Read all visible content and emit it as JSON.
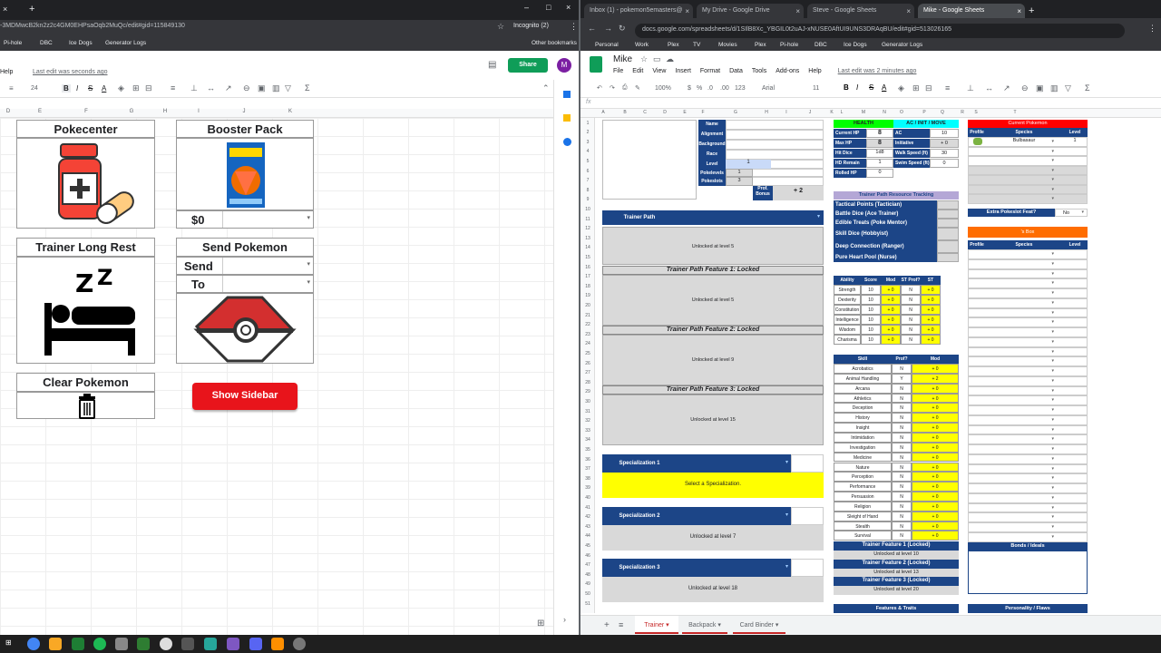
{
  "left": {
    "url": "-3MDMwcB2kn2z2c4GM0EHPsaOqb2MuQc/edit#gid=115849130",
    "incognito": "Incognito (2)",
    "bookmarks": [
      "Pi-hole",
      "DBC",
      "Ice Dogs",
      "Generator Logs"
    ],
    "other_bookmarks": "Other bookmarks",
    "menu_help": "Help",
    "last_edit": "Last edit was seconds ago",
    "share": "Share",
    "avatar": "M",
    "font_size": "24",
    "columns": [
      "D",
      "E",
      "F",
      "G",
      "H",
      "I",
      "J",
      "K"
    ],
    "cards": {
      "pokecenter": "Pokecenter",
      "booster": "Booster Pack",
      "money": "$0",
      "long_rest": "Trainer Long Rest",
      "send_pokemon": "Send Pokemon",
      "send": "Send",
      "to": "To",
      "clear_pokemon": "Clear Pokemon",
      "show_sidebar": "Show Sidebar"
    }
  },
  "right": {
    "tabs": [
      "Inbox (1) - pokemon5emasters@",
      "My Drive - Google Drive",
      "Steve - Google Sheets",
      "Mike - Google Sheets"
    ],
    "url": "docs.google.com/spreadsheets/d/1SIlB8Xc_YBGIL0t2uAJ-xNUSE0AftUI9UNS3DRAqBU/edit#gid=513026165",
    "bookmarks": [
      "Personal",
      "Work",
      "Plex",
      "TV",
      "Movies",
      "Plex",
      "Pi-hole",
      "DBC",
      "Ice Dogs",
      "Generator Logs"
    ],
    "title": "Mike",
    "menu": [
      "File",
      "Edit",
      "View",
      "Insert",
      "Format",
      "Data",
      "Tools",
      "Add-ons",
      "Help"
    ],
    "last_edit": "Last edit was 2 minutes ago",
    "toolbar": {
      "zoom": "100%",
      "currency": "$",
      "percent": "%",
      "dec0": ".0",
      "dec00": ".00",
      "format": "123",
      "font": "Arial",
      "size": "11"
    },
    "fx": "fx",
    "cols": [
      "A",
      "B",
      "C",
      "D",
      "E",
      "F",
      "G",
      "H",
      "I",
      "J",
      "K",
      "L",
      "M",
      "N",
      "O",
      "P",
      "Q",
      "R",
      "S",
      "T"
    ],
    "char_labels": [
      "Name",
      "Alignment",
      "Background",
      "Race",
      "Level",
      "Pokelevels",
      "Pokeslots"
    ],
    "level": "1",
    "pokelevels": "1",
    "pokeslots": "3",
    "prof_bonus_label": "Prof. Bonus",
    "prof_bonus": "+ 2",
    "health_hdr": "HEALTH",
    "ac_hdr": "AC / INIT / MOVE",
    "health": [
      [
        "Current HP",
        "8"
      ],
      [
        "Max HP",
        "8"
      ],
      [
        "Hit Dice",
        "1d8"
      ],
      [
        "HD Remain",
        "1"
      ],
      [
        "Rolled HP",
        "0"
      ]
    ],
    "ac": [
      [
        "AC",
        "10"
      ],
      [
        "Initiative",
        "+ 0"
      ],
      [
        "Walk Speed (ft)",
        "30"
      ],
      [
        "Swim Speed (ft)",
        "0"
      ]
    ],
    "trainer_path": "Trainer Path",
    "unlocked5": "Unlocked at level 5",
    "feat1": "Trainer Path Feature 1: Locked",
    "feat2": "Trainer Path Feature 2: Locked",
    "feat3": "Trainer Path Feature 3: Locked",
    "unlocked9": "Unlocked at level 9",
    "unlocked15": "Unlocked at level 15",
    "spec1": "Specialization 1",
    "spec_select": "Select a Specialization.",
    "spec2": "Specialization 2",
    "unlocked7": "Unlocked at level 7",
    "spec3": "Specialization 3",
    "unlocked18": "Unlocked at level 18",
    "resource_hdr": "Trainer Path Resource Tracking",
    "resources": [
      "Tactical Points (Tactician)",
      "Battle Dice (Ace Trainer)",
      "Edible Treats (Poke Mentor)",
      "Skill Dice (Hobbyist)",
      "Deep Connection (Ranger)",
      "Pure Heart Pool (Nurse)"
    ],
    "ability_hdr": [
      "Ability",
      "Score",
      "Mod",
      "ST Prof?",
      "ST"
    ],
    "abilities": [
      [
        "Strength",
        "10",
        "+ 0",
        "N",
        "+ 0"
      ],
      [
        "Dexterity",
        "10",
        "+ 0",
        "N",
        "+ 0"
      ],
      [
        "Constitution",
        "10",
        "+ 0",
        "N",
        "+ 0"
      ],
      [
        "Intelligence",
        "10",
        "+ 0",
        "N",
        "+ 0"
      ],
      [
        "Wisdom",
        "10",
        "+ 0",
        "N",
        "+ 0"
      ],
      [
        "Charisma",
        "10",
        "+ 0",
        "N",
        "+ 0"
      ]
    ],
    "skill_hdr": [
      "Skill",
      "Prof?",
      "Mod"
    ],
    "skills": [
      [
        "Acrobatics",
        "N",
        "+ 0"
      ],
      [
        "Animal Handling",
        "Y",
        "+ 2"
      ],
      [
        "Arcana",
        "N",
        "+ 0"
      ],
      [
        "Athletics",
        "N",
        "+ 0"
      ],
      [
        "Deception",
        "N",
        "+ 0"
      ],
      [
        "History",
        "N",
        "+ 0"
      ],
      [
        "Insight",
        "N",
        "+ 0"
      ],
      [
        "Intimidation",
        "N",
        "+ 0"
      ],
      [
        "Investigation",
        "N",
        "+ 0"
      ],
      [
        "Medicine",
        "N",
        "+ 0"
      ],
      [
        "Nature",
        "N",
        "+ 0"
      ],
      [
        "Perception",
        "N",
        "+ 0"
      ],
      [
        "Performance",
        "N",
        "+ 0"
      ],
      [
        "Persuasion",
        "N",
        "+ 0"
      ],
      [
        "Religion",
        "N",
        "+ 0"
      ],
      [
        "Sleight of Hand",
        "N",
        "+ 0"
      ],
      [
        "Stealth",
        "N",
        "+ 0"
      ],
      [
        "Survival",
        "N",
        "+ 0"
      ]
    ],
    "tfeat": [
      [
        "Trainer Feature 1 (Locked)",
        "Unlocked at level 10"
      ],
      [
        "Trainer Feature 2 (Locked)",
        "Unlocked at level 13"
      ],
      [
        "Trainer Feature 3 (Locked)",
        "Unlocked at level 20"
      ]
    ],
    "features_traits": "Features & Traits",
    "current_pokemon": "Current Pokemon",
    "poke_hdr": [
      "Profile",
      "Species",
      "Level"
    ],
    "bulbasaur": "Bulbasaur",
    "bulbasaur_level": "1",
    "extra_feat": "Extra Pokeslot Feat?",
    "extra_val": "No",
    "box": "'s Box",
    "bonds": "Bonds / Ideals",
    "personality": "Personality / Flaws",
    "sheet_tabs": [
      "Trainer",
      "Backpack",
      "Card Binder"
    ],
    "colors": {
      "navy": "#1c4587",
      "yellow": "#ffff00",
      "red": "#ff0000",
      "orange": "#ff6d01",
      "teal": "#00ffff",
      "green": "#00ff00",
      "purple": "#b4a7d6"
    }
  }
}
